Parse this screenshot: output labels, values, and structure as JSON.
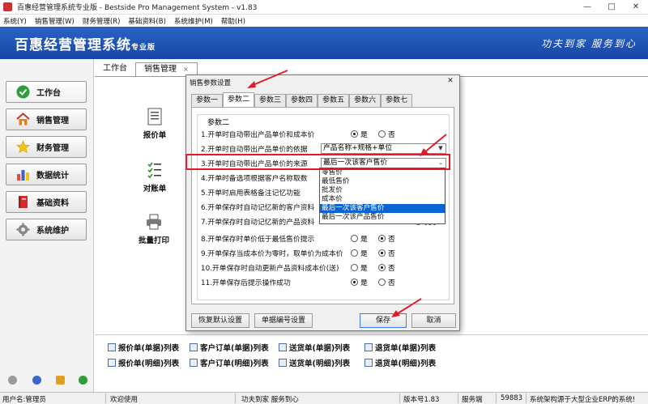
{
  "window": {
    "title": "百惠经营管理系统专业版 - Bestside Pro Management System - v1.83",
    "controls": [
      "—",
      "□",
      "✕"
    ]
  },
  "menu": [
    "系统(Y)",
    "销售管理(W)",
    "财务管理(R)",
    "基础资料(B)",
    "系统维护(M)",
    "帮助(H)"
  ],
  "banner": {
    "brand": "百惠经营管理系统",
    "edition": "专业版",
    "slogan": "功夫到家 服务到心"
  },
  "sidebar": {
    "items": [
      {
        "label": "工作台",
        "icon": "check-circle-icon"
      },
      {
        "label": "销售管理",
        "icon": "home-icon"
      },
      {
        "label": "财务管理",
        "icon": "star-icon"
      },
      {
        "label": "数据统计",
        "icon": "bar-chart-icon"
      },
      {
        "label": "基础资料",
        "icon": "book-icon"
      },
      {
        "label": "系统维护",
        "icon": "gear-icon"
      }
    ]
  },
  "tabs": {
    "workbench": "工作台",
    "sales": "销售管理",
    "close": "×"
  },
  "main_icons": {
    "quote": "报价单",
    "reconcile": "对账单",
    "batch_print": "批量打印"
  },
  "dialog": {
    "title": "销售参数设置",
    "tabs": [
      "参数一",
      "参数二",
      "参数三",
      "参数四",
      "参数五",
      "参数六",
      "参数七"
    ],
    "active_tab": "参数二",
    "group_label": "参数二",
    "rows": [
      "1.开单时自动带出产品单价和成本价",
      "2.开单时自动带出产品单价的依据",
      "3.开单时自动带出产品单价的来源",
      "4.开单时备选项根据客户名称取数",
      "5.开单时启用表格备注记忆功能",
      "6.开单保存时自动记忆新的客户资料",
      "7.开单保存时自动记忆新的产品资料",
      "8.开单保存时单价低于最低售价提示",
      "9.开单保存当成本价为零时，取单价为成本价",
      "10.开单保存时自动更新产品资料成本价(送)",
      "11.开单保存后提示操作成功"
    ],
    "yes": "是",
    "no": "否",
    "basis_value": "产品名称+规格+单位",
    "source_value": "最后一次该客户售价",
    "source_options": [
      "零售价",
      "最低售价",
      "批发价",
      "成本价",
      "最后一次该客户售价",
      "最后一次该产品售价"
    ],
    "source_selected_index": 4,
    "partial_hint": "提示",
    "buttons": {
      "restore": "恢复默认设置",
      "numbering": "单据编号设置",
      "save": "保存",
      "cancel": "取消"
    }
  },
  "bottom_links": [
    [
      "报价单(单据)列表",
      "客户订单(单据)列表",
      "送货单(单据)列表",
      "退货单(单据)列表"
    ],
    [
      "报价单(明细)列表",
      "客户订单(明细)列表",
      "送货单(明细)列表",
      "退货单(明细)列表"
    ]
  ],
  "statusbar": {
    "user": "用户名:管理员",
    "welcome": "欢迎使用",
    "motto": "功夫到家 服务到心",
    "version": "版本号1.83",
    "server_label": "服务端",
    "server_port": "59883",
    "note": "系统架构源于大型企业ERP的系统!"
  },
  "colors": {
    "banner": "#1f56b8",
    "highlight": "#e21b2a",
    "selection": "#0a64d2"
  }
}
